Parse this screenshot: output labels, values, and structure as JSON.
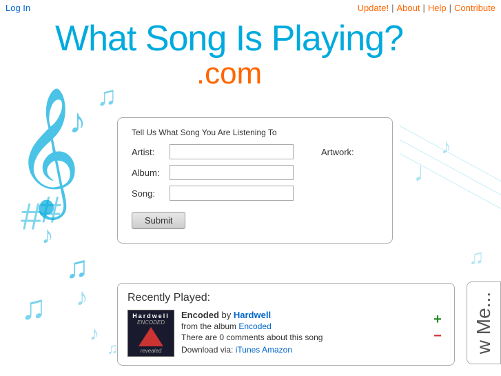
{
  "nav": {
    "login": "Log In",
    "update": "Update!",
    "about": "About",
    "help": "Help",
    "contribute": "Contribute"
  },
  "logo": {
    "title": "What Song Is Playing?",
    "com": ".com"
  },
  "form": {
    "title": "Tell Us What Song You Are Listening To",
    "artist_label": "Artist:",
    "album_label": "Album:",
    "song_label": "Song:",
    "artwork_label": "Artwork:",
    "submit_label": "Submit"
  },
  "recently": {
    "title": "Recently Played:",
    "song_name": "Encoded",
    "artist_name": "Hardwell",
    "album_name": "Encoded",
    "comments": "There are 0 comments about this song",
    "download_text": "Download via:",
    "itunes": "iTunes",
    "amazon": "Amazon"
  },
  "right_panel": {
    "text": "w Me..."
  },
  "icons": {
    "plus": "+",
    "minus": "−"
  }
}
